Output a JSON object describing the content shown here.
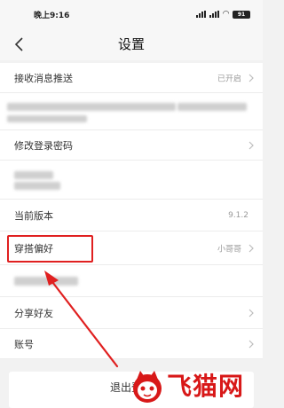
{
  "status_bar": {
    "time": "晚上9:16",
    "battery": "91"
  },
  "header": {
    "title": "设置"
  },
  "rows": [
    {
      "label": "接收消息推送",
      "value": "已开启"
    },
    {
      "label": "修改登录密码",
      "value": ""
    },
    {
      "label": "当前版本",
      "value": "9.1.2"
    },
    {
      "label": "穿搭偏好",
      "value": "小哥哥"
    },
    {
      "label": "分享好友",
      "value": ""
    },
    {
      "label": "账号",
      "value": ""
    }
  ],
  "logout_label": "退出登录",
  "watermark": {
    "text": "飞猫网"
  },
  "colors": {
    "annotation": "#e02020",
    "watermark": "#d81818"
  }
}
